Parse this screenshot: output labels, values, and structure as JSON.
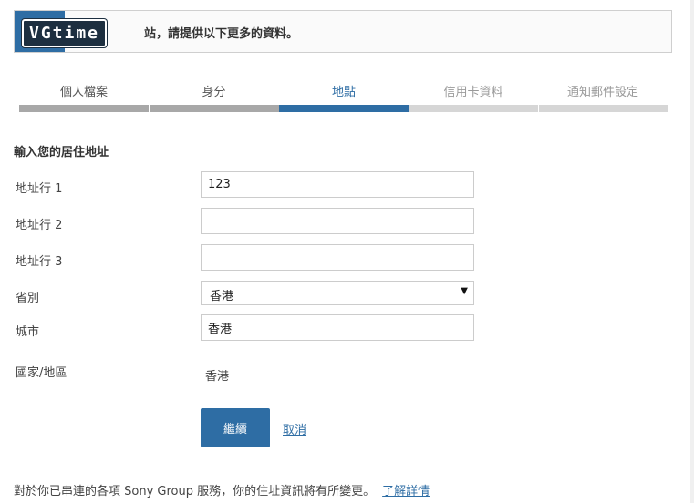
{
  "banner": {
    "logo_text": "VGtime",
    "message": "站，請提供以下更多的資料。"
  },
  "steps": [
    {
      "label": "個人檔案",
      "state": "done"
    },
    {
      "label": "身分",
      "state": "done"
    },
    {
      "label": "地點",
      "state": "current"
    },
    {
      "label": "信用卡資料",
      "state": "todo"
    },
    {
      "label": "通知郵件設定",
      "state": "todo"
    }
  ],
  "form": {
    "section_title": "輸入您的居住地址",
    "address1": {
      "label": "地址行 1",
      "value": "123"
    },
    "address2": {
      "label": "地址行 2",
      "value": ""
    },
    "address3": {
      "label": "地址行 3",
      "value": ""
    },
    "province": {
      "label": "省別",
      "value": "香港"
    },
    "city": {
      "label": "城市",
      "value": "香港"
    },
    "country": {
      "label": "國家/地區",
      "value": "香港"
    }
  },
  "actions": {
    "continue_label": "繼續",
    "cancel_label": "取消"
  },
  "footer": {
    "text": "對於你已串連的各項 Sony Group 服務，你的住址資訊將有所變更。",
    "link_label": "了解詳情"
  },
  "colors": {
    "accent": "#2e6da4",
    "done_bar": "#a8a8a8",
    "todo_bar": "#d6d6d6"
  }
}
